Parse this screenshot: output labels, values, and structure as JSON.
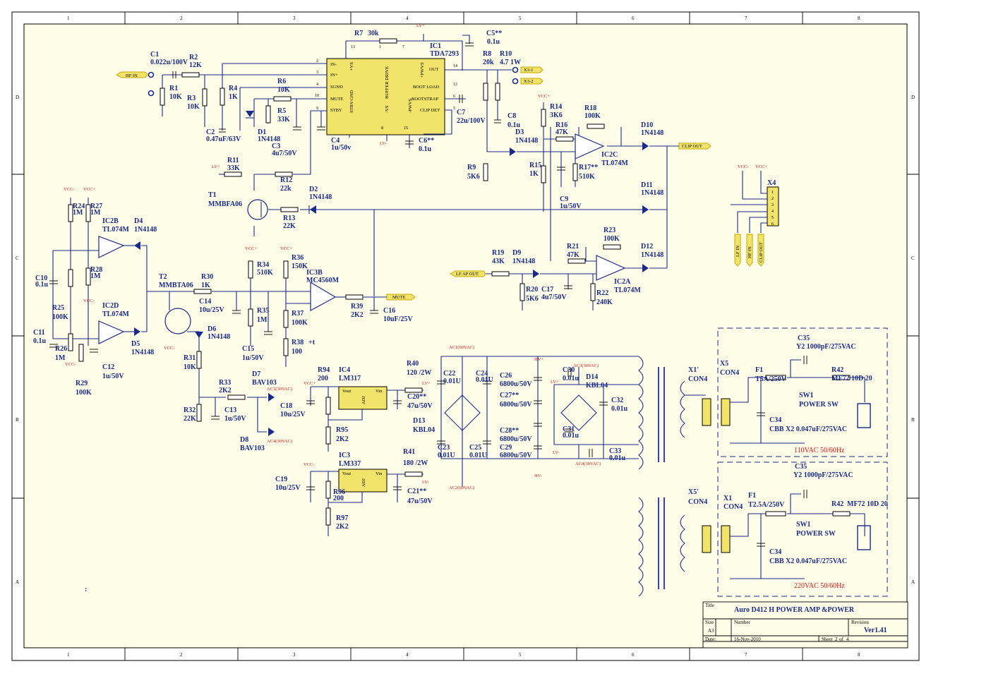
{
  "border": {
    "columns": [
      "1",
      "2",
      "3",
      "4",
      "5",
      "6",
      "7",
      "8"
    ],
    "rows": [
      "D",
      "C",
      "B",
      "A"
    ]
  },
  "title_block": {
    "title_label": "Title",
    "title": "Auro D412 H POWER AMP &POWER",
    "size_label": "Size",
    "size": "A3",
    "number_label": "Number",
    "revision_label": "Revision",
    "revision": "Ver1.41",
    "date_label": "Date:",
    "date": "16-Nov-2010",
    "sheet_label": "Sheet",
    "sheet": "2",
    "of_label": "of",
    "of": "4"
  },
  "stray_text": ":",
  "ic1": {
    "ref": "IC1",
    "part": "TDA7293",
    "pins_left": [
      "IN-",
      "IN+",
      "SGND",
      "MUTE",
      "STBY"
    ],
    "pins_right": [
      "OUT",
      "BOOT LOAD",
      "BOOTSTRAP",
      "CLIP DET"
    ],
    "pins_vertical": [
      "+VS",
      "BUFFER DRIVE",
      "STBY-GND",
      "-VS",
      "+PWVS",
      "-PWVS"
    ],
    "pin_numbers": [
      "2",
      "3",
      "4",
      "10",
      "9",
      "13",
      "14",
      "12",
      "6",
      "5",
      "8",
      "15",
      "7",
      "1"
    ]
  },
  "labels": [
    {
      "id": "r7",
      "text": "R7",
      "value": "30k"
    },
    {
      "id": "c5",
      "text": "C5**",
      "value": "0.1u"
    },
    {
      "id": "c1",
      "text": "C1",
      "value": "0.022u/100V"
    },
    {
      "id": "r2",
      "text": "R2",
      "value": "12K"
    },
    {
      "id": "r1",
      "text": "R1",
      "value": "10K"
    },
    {
      "id": "r3",
      "text": "R3",
      "value": "10K"
    },
    {
      "id": "r4",
      "text": "R4",
      "value": "1K"
    },
    {
      "id": "r6",
      "text": "R6",
      "value": "10K"
    },
    {
      "id": "r5",
      "text": "R5",
      "value": "33K"
    },
    {
      "id": "d1",
      "text": "D1",
      "value": "1N4148"
    },
    {
      "id": "c2",
      "text": "C2",
      "value": "0.47uF/63V"
    },
    {
      "id": "c3",
      "text": "C3",
      "value": "4u7/50V"
    },
    {
      "id": "c4",
      "text": "C4",
      "value": "1u/50v"
    },
    {
      "id": "r8",
      "text": "R8",
      "value": "20k"
    },
    {
      "id": "r10",
      "text": "R10",
      "value": "4.7 1W"
    },
    {
      "id": "c7",
      "text": "C7",
      "value": "22u/100V"
    },
    {
      "id": "c6",
      "text": "C6**",
      "value": "0.1u"
    },
    {
      "id": "c8",
      "text": "C8",
      "value": "0.1u"
    },
    {
      "id": "r14",
      "text": "R14",
      "value": "3K6"
    },
    {
      "id": "r18",
      "text": "R18",
      "value": "100K"
    },
    {
      "id": "r16",
      "text": "R16",
      "value": "47K"
    },
    {
      "id": "d3",
      "text": "D3",
      "value": "1N4148"
    },
    {
      "id": "ic2c",
      "text": "IC2C",
      "value": "TL074M"
    },
    {
      "id": "d10",
      "text": "D10",
      "value": "1N4148"
    },
    {
      "id": "r9",
      "text": "R9",
      "value": "5K6"
    },
    {
      "id": "r15",
      "text": "R15",
      "value": "1K"
    },
    {
      "id": "r17",
      "text": "R17**",
      "value": "510K"
    },
    {
      "id": "c9",
      "text": "C9",
      "value": "1u/50V"
    },
    {
      "id": "d11",
      "text": "D11",
      "value": "1N4148"
    },
    {
      "id": "r11",
      "text": "R11",
      "value": "33K"
    },
    {
      "id": "r12",
      "text": "R12",
      "value": "22k"
    },
    {
      "id": "t1",
      "text": "T1",
      "value": "MMBFA06"
    },
    {
      "id": "r13",
      "text": "R13",
      "value": "22K"
    },
    {
      "id": "d2",
      "text": "D2",
      "value": "1N4148"
    },
    {
      "id": "r23",
      "text": "R23",
      "value": "100K"
    },
    {
      "id": "r21",
      "text": "R21",
      "value": "47K"
    },
    {
      "id": "d12",
      "text": "D12",
      "value": "1N4148"
    },
    {
      "id": "r19",
      "text": "R19",
      "value": "43K"
    },
    {
      "id": "d9",
      "text": "D9",
      "value": "1N4148"
    },
    {
      "id": "ic2a",
      "text": "IC2A",
      "value": "TL074M"
    },
    {
      "id": "r20",
      "text": "R20",
      "value": "5K6"
    },
    {
      "id": "c17",
      "text": "C17",
      "value": "4u7/50V"
    },
    {
      "id": "r22",
      "text": "R22",
      "value": "240K"
    },
    {
      "id": "r24",
      "text": "R24",
      "value": "1M"
    },
    {
      "id": "r27",
      "text": "R27",
      "value": "1M"
    },
    {
      "id": "ic2b",
      "text": "IC2B",
      "value": "TL074M"
    },
    {
      "id": "d4",
      "text": "D4",
      "value": "1N4148"
    },
    {
      "id": "r28",
      "text": "R28",
      "value": "1M"
    },
    {
      "id": "c10",
      "text": "C10",
      "value": "0.1u"
    },
    {
      "id": "r25",
      "text": "R25",
      "value": "100K"
    },
    {
      "id": "ic2d",
      "text": "IC2D",
      "value": "TL074M"
    },
    {
      "id": "c11",
      "text": "C11",
      "value": "0.1u"
    },
    {
      "id": "r26",
      "text": "R26",
      "value": "1M"
    },
    {
      "id": "d5",
      "text": "D5",
      "value": "1N4148"
    },
    {
      "id": "c12",
      "text": "C12",
      "value": "1u/50V"
    },
    {
      "id": "r29",
      "text": "R29",
      "value": "100K"
    },
    {
      "id": "t2",
      "text": "T2",
      "value": "MMBTA06"
    },
    {
      "id": "r30",
      "text": "R30",
      "value": "1K"
    },
    {
      "id": "c14",
      "text": "C14",
      "value": "10u/25V"
    },
    {
      "id": "r34",
      "text": "R34",
      "value": "510K"
    },
    {
      "id": "r36",
      "text": "R36",
      "value": "150K"
    },
    {
      "id": "ic3b",
      "text": "IC3B",
      "value": "MC4560M"
    },
    {
      "id": "r39",
      "text": "R39",
      "value": "2K2"
    },
    {
      "id": "c16",
      "text": "C16",
      "value": "10uF/25V"
    },
    {
      "id": "r35",
      "text": "R35",
      "value": "1M"
    },
    {
      "id": "r37",
      "text": "R37",
      "value": "100K"
    },
    {
      "id": "r38",
      "text": "R38",
      "value": "100"
    },
    {
      "id": "d6",
      "text": "D6",
      "value": "1N4148"
    },
    {
      "id": "r31",
      "text": "R31",
      "value": "10K"
    },
    {
      "id": "c15",
      "text": "C15",
      "value": "1u/50V"
    },
    {
      "id": "d7",
      "text": "D7",
      "value": "BAV103"
    },
    {
      "id": "r33",
      "text": "R33",
      "value": "2K2"
    },
    {
      "id": "c13",
      "text": "C13",
      "value": "1u/50V"
    },
    {
      "id": "c18",
      "text": "C18",
      "value": "10u/25V"
    },
    {
      "id": "r32",
      "text": "R32",
      "value": "22K"
    },
    {
      "id": "d8",
      "text": "D8",
      "value": "BAV103"
    },
    {
      "id": "r94",
      "text": "R94",
      "value": "200"
    },
    {
      "id": "ic4",
      "text": "IC4",
      "value": "LM317"
    },
    {
      "id": "r40",
      "text": "R40",
      "value": "120 /2W"
    },
    {
      "id": "c20",
      "text": "C20**",
      "value": "47u/50V"
    },
    {
      "id": "r95",
      "text": "R95",
      "value": "2K2"
    },
    {
      "id": "c19",
      "text": "C19",
      "value": "10u/25V"
    },
    {
      "id": "ic3",
      "text": "IC3",
      "value": "LM337"
    },
    {
      "id": "r41",
      "text": "R41",
      "value": "180 /2W"
    },
    {
      "id": "r96",
      "text": "R96",
      "value": "200"
    },
    {
      "id": "c21",
      "text": "C21**",
      "value": "47u/50V"
    },
    {
      "id": "r97",
      "text": "R97",
      "value": "2K2"
    },
    {
      "id": "c22",
      "text": "C22",
      "value": "0.01U"
    },
    {
      "id": "c24",
      "text": "C24",
      "value": "0.01U"
    },
    {
      "id": "c26",
      "text": "C26",
      "value": "6800u/50V"
    },
    {
      "id": "c27",
      "text": "C27**",
      "value": "6800u/50V"
    },
    {
      "id": "d13",
      "text": "D13",
      "value": "KBL04"
    },
    {
      "id": "c28",
      "text": "C28**",
      "value": "6800u/50V"
    },
    {
      "id": "c29",
      "text": "C29",
      "value": "6800u/50V"
    },
    {
      "id": "c23",
      "text": "C23",
      "value": "0.01U"
    },
    {
      "id": "c25",
      "text": "C25",
      "value": "0.01U"
    },
    {
      "id": "c30",
      "text": "C30",
      "value": "0.01u"
    },
    {
      "id": "d14",
      "text": "D14",
      "value": "KBL04"
    },
    {
      "id": "c32",
      "text": "C32",
      "value": "0.01u"
    },
    {
      "id": "c31",
      "text": "C31",
      "value": "0.01u"
    },
    {
      "id": "c33",
      "text": "C33",
      "value": "0.01u"
    },
    {
      "id": "x4",
      "text": "X4",
      "value": ""
    },
    {
      "id": "x1p",
      "text": "X1'",
      "value": "CON4"
    },
    {
      "id": "x5",
      "text": "X5",
      "value": "CON4"
    },
    {
      "id": "x5p",
      "text": "X5'",
      "value": "CON4"
    },
    {
      "id": "x1",
      "text": "X1",
      "value": "CON4"
    },
    {
      "id": "f1a",
      "text": "F1",
      "value": "T5A/250V"
    },
    {
      "id": "f1b",
      "text": "F1",
      "value": "T2.5A/250V"
    },
    {
      "id": "c35a",
      "text": "C35",
      "value": "Y2 1000pF/275VAC"
    },
    {
      "id": "c35b",
      "text": "C35",
      "value": "Y2 1000pF/275VAC"
    },
    {
      "id": "r42a",
      "text": "R42",
      "value": "MF72 10D 20"
    },
    {
      "id": "r42b",
      "text": "R42",
      "value": "MF72 10D 20"
    },
    {
      "id": "sw1a",
      "text": "SW1",
      "value": "POWER  SW"
    },
    {
      "id": "sw1b",
      "text": "SW1",
      "value": "POWER  SW"
    },
    {
      "id": "c34a",
      "text": "C34",
      "value": "CBB X2 0.047uF/275VAC"
    },
    {
      "id": "c34b",
      "text": "C34",
      "value": "CBB X2 0.047uF/275VAC"
    }
  ],
  "nets": {
    "hf_in": "HF IN",
    "x3_1": "X3-1",
    "x3_2": "X3-2",
    "clip_out": "CLIP OUT",
    "lf_ap_out": "LF AP OUT",
    "mute": "MUTE",
    "lf_in": "LF IN",
    "vcc_plus": "VCC+",
    "vcc_minus": "VCC-",
    "lv_plus": "LV+",
    "lv_minus": "LV-",
    "hv_plus": "HV+",
    "hv_minus": "HV-",
    "ac1": "AC1(60VAC)",
    "ac2": "AC2(60VAC)",
    "ac3": "AC3(30VAC)",
    "ac4": "AC4(30VAC)",
    "plus_t": "+t"
  },
  "mains": {
    "label_110": "110VAC 50/60Hz",
    "label_220": "220VAC 50/60Hz"
  },
  "colors": {
    "wire": "#1a2a8a",
    "net_label": "#d01010",
    "net_flag": "#f2e36a",
    "border": "#000000",
    "sheet_bg": "#fefee8"
  }
}
